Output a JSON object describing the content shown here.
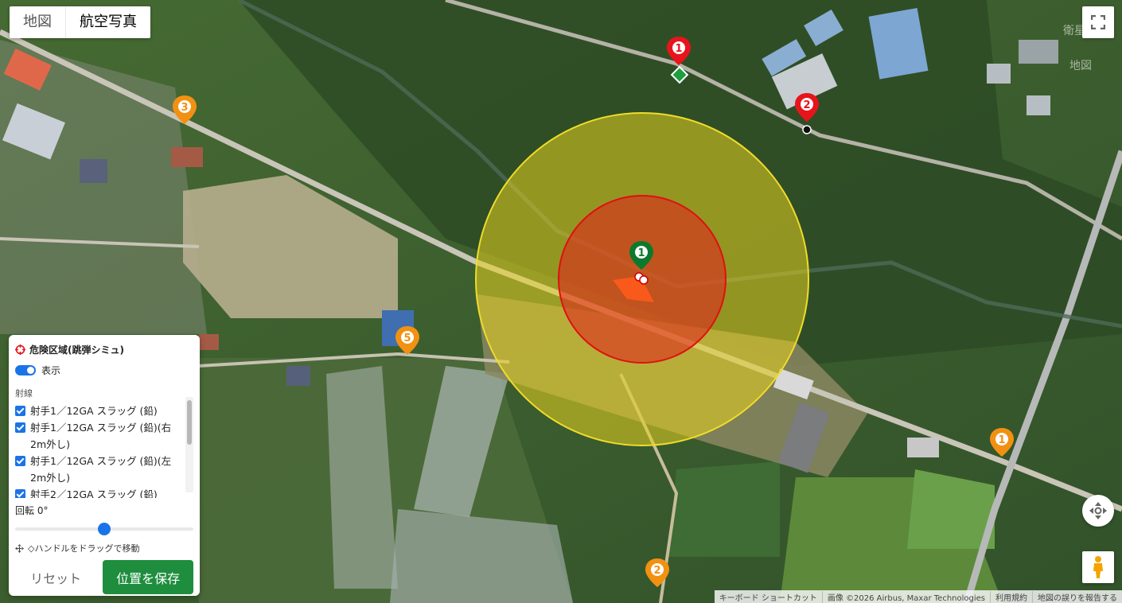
{
  "map": {
    "type_tabs": [
      "地図",
      "航空写真"
    ],
    "active_tab": "航空写真",
    "faint_labels": [
      "衛星",
      "地図"
    ],
    "attribution": [
      "キーボード ショートカット",
      "画像 ©2026 Airbus, Maxar Technologies",
      "利用規約",
      "地図の誤りを報告する"
    ],
    "markers": [
      {
        "label": "1",
        "color": "#e8141c",
        "kind": "shooter"
      },
      {
        "label": "2",
        "color": "#e8141c",
        "kind": "shooter"
      },
      {
        "label": "1",
        "color": "#0c7a2c",
        "kind": "target"
      },
      {
        "label": "1",
        "color": "#f29111",
        "kind": "point"
      },
      {
        "label": "2",
        "color": "#f29111",
        "kind": "point"
      },
      {
        "label": "3",
        "color": "#f29111",
        "kind": "point"
      },
      {
        "label": "5",
        "color": "#f29111",
        "kind": "point"
      }
    ],
    "icons": [
      "fullscreen-icon",
      "camera-move-icon",
      "street-view-pegman-icon"
    ],
    "danger_zone_colors": {
      "outer": "#e8d21f",
      "inner": "#e61e1e"
    }
  },
  "panel": {
    "title": "危険区域(跳弾シミュ)",
    "toggle_label": "表示",
    "toggle_on": true,
    "section_label": "射線",
    "items": [
      "射手1／12GA スラッグ (鉛)",
      "射手1／12GA スラッグ (鉛)(右2m外し)",
      "射手1／12GA スラッグ (鉛)(左2m外し)",
      "射手2／12GA スラッグ (鉛)"
    ],
    "rotation_label": "回転 0°",
    "rotation_value": 0,
    "rotation_fraction": 0.5,
    "hint": "◇ハンドルをドラッグで移動",
    "reset_label": "リセット",
    "save_label": "位置を保存"
  },
  "colors": {
    "accent": "#1a73e8",
    "save": "#1e8e3e"
  }
}
